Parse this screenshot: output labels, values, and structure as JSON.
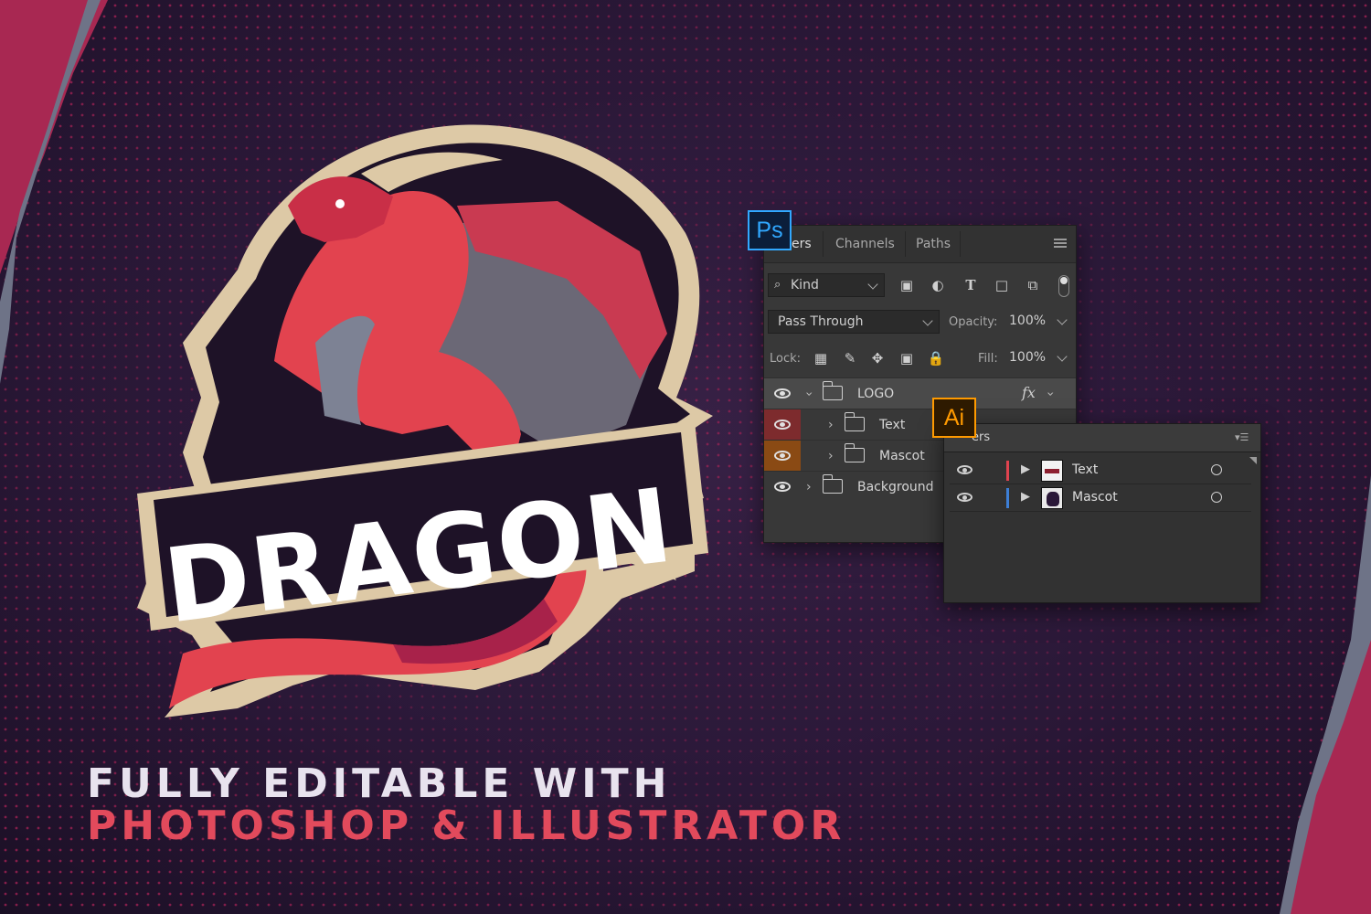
{
  "colors": {
    "background": "#2a1838",
    "accent_red": "#e24a5c",
    "ps_blue": "#31a8ff",
    "ai_orange": "#ff9a00",
    "cream": "#ddc9a6"
  },
  "logo": {
    "wordmark": "DRAGON"
  },
  "headline": {
    "line1": "FULLY EDITABLE WITH",
    "line2": "PHOTOSHOP & ILLUSTRATOR"
  },
  "ps_badge": "Ps",
  "ai_badge": "Ai",
  "ps_panel": {
    "tabs": [
      "ers",
      "Channels",
      "Paths"
    ],
    "filter_kind": "Kind",
    "blend_mode": "Pass Through",
    "opacity_label": "Opacity:",
    "opacity_value": "100%",
    "lock_label": "Lock:",
    "fill_label": "Fill:",
    "fill_value": "100%",
    "fx_label": "fx",
    "layers": [
      {
        "name": "LOGO",
        "label_color": "none"
      },
      {
        "name": "Text",
        "label_color": "red"
      },
      {
        "name": "Mascot",
        "label_color": "orange"
      },
      {
        "name": "Background",
        "label_color": "none"
      }
    ]
  },
  "ai_panel": {
    "tab": "ers",
    "layers": [
      {
        "name": "Text",
        "color": "#e0434f"
      },
      {
        "name": "Mascot",
        "color": "#3d7fd6"
      }
    ]
  }
}
